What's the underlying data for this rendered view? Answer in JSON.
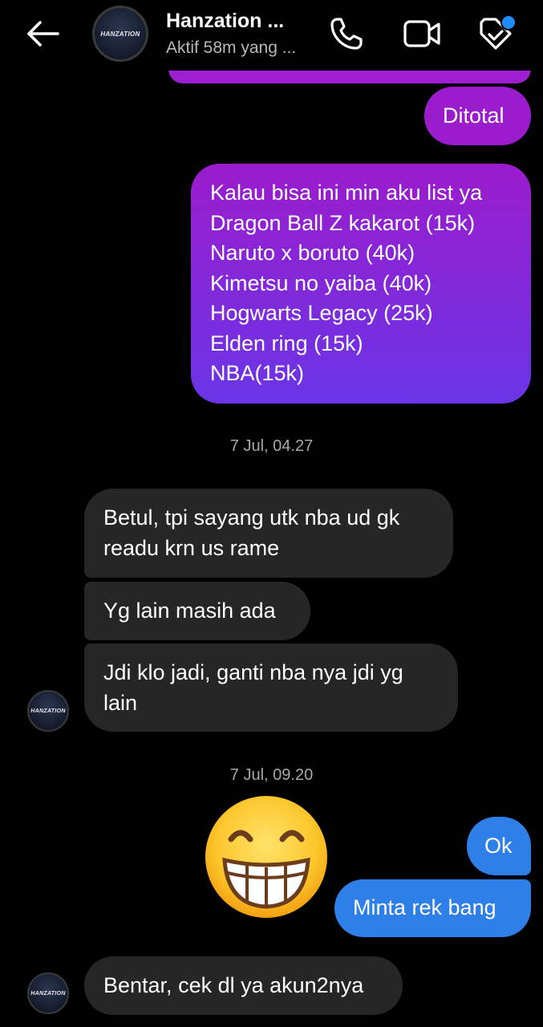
{
  "header": {
    "contact_name": "Hanzation ...",
    "status": "Aktif 58m yang ...",
    "avatar_text": "HANZATION",
    "icons": [
      "back-arrow-icon",
      "phone-icon",
      "video-camera-icon",
      "tag-icon"
    ]
  },
  "messages": {
    "ditotal": "Ditotal",
    "list": "Kalau bisa ini min aku list ya\nDragon Ball Z kakarot (15k)\nNaruto x boruto (40k)\nKimetsu no yaiba (40k)\nHogwarts Legacy (25k)\nElden ring (15k)\nNBA(15k)",
    "stamp1": "7 Jul, 04.27",
    "reply1": "Betul, tpi sayang utk nba ud gk\nreadu krn us rame",
    "reply2": "Yg lain masih ada",
    "reply3": "Jdi klo jadi, ganti nba nya jdi yg\nlain",
    "stamp2": "7 Jul, 09.20",
    "ok": "Ok",
    "minta": "Minta rek bang",
    "bentar": "Bentar, cek dl ya akun2nya"
  },
  "colors": {
    "sent_purple_top": "#9b1ccd",
    "sent_purple_bottom": "#6a35e6",
    "sent_blue": "#2f7fe8",
    "received": "#262626",
    "unread_dot": "#1d8cf8"
  }
}
